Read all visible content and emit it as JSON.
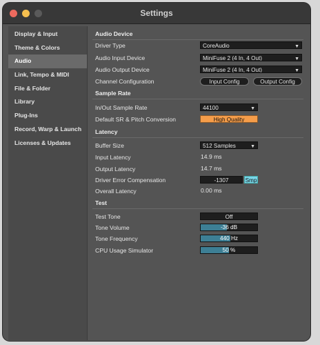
{
  "window": {
    "title": "Settings"
  },
  "sidebar": {
    "items": [
      {
        "label": "Display & Input"
      },
      {
        "label": "Theme & Colors"
      },
      {
        "label": "Audio",
        "active": true
      },
      {
        "label": "Link, Tempo & MIDI"
      },
      {
        "label": "File & Folder"
      },
      {
        "label": "Library"
      },
      {
        "label": "Plug-Ins"
      },
      {
        "label": "Record, Warp & Launch"
      },
      {
        "label": "Licenses & Updates"
      }
    ]
  },
  "audio_device": {
    "section": "Audio Device",
    "driver_type": {
      "label": "Driver Type",
      "value": "CoreAudio"
    },
    "input_device": {
      "label": "Audio Input Device",
      "value": "MiniFuse 2 (4 In, 4 Out)"
    },
    "output_device": {
      "label": "Audio Output Device",
      "value": "MiniFuse 2 (4 In, 4 Out)"
    },
    "channel_config": {
      "label": "Channel Configuration",
      "input_button": "Input Config",
      "output_button": "Output Config"
    }
  },
  "sample_rate": {
    "section": "Sample Rate",
    "in_out": {
      "label": "In/Out Sample Rate",
      "value": "44100"
    },
    "conversion": {
      "label": "Default SR & Pitch Conversion",
      "value": "High Quality"
    }
  },
  "latency": {
    "section": "Latency",
    "buffer_size": {
      "label": "Buffer Size",
      "value": "512 Samples"
    },
    "input_latency": {
      "label": "Input Latency",
      "value": "14.9 ms"
    },
    "output_latency": {
      "label": "Output Latency",
      "value": "14.7 ms"
    },
    "driver_error": {
      "label": "Driver Error Compensation",
      "value": "-1307",
      "unit": "Smp"
    },
    "overall": {
      "label": "Overall Latency",
      "value": "0.00 ms"
    }
  },
  "test": {
    "section": "Test",
    "tone": {
      "label": "Test Tone",
      "value": "Off"
    },
    "volume": {
      "label": "Tone Volume",
      "value": "-36 dB",
      "level_percent": 46
    },
    "frequency": {
      "label": "Tone Frequency",
      "value": "440 Hz",
      "level_percent": 52
    },
    "cpu": {
      "label": "CPU Usage Simulator",
      "value": "50 %",
      "level_percent": 50
    }
  },
  "colors": {
    "accent_orange": "#f59d4a",
    "slider_fill": "#3d7f95",
    "smp_badge": "#7ad6e8",
    "active_nav": "#6a6a6a"
  }
}
